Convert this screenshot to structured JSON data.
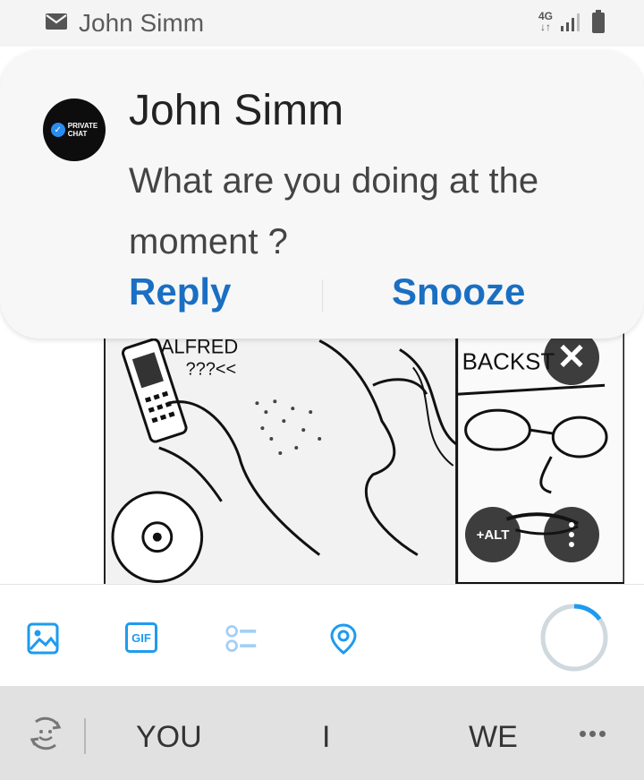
{
  "status_bar": {
    "sender": "John Simm",
    "network_type": "4G",
    "icons": [
      "mail-icon",
      "data-arrows-icon",
      "signal-icon",
      "battery-icon"
    ]
  },
  "notification": {
    "avatar_text_line1": "PRIVATE",
    "avatar_text_line2": "CHAT",
    "title": "John Simm",
    "message": "What are you doing at the moment ?",
    "actions": {
      "reply": "Reply",
      "snooze": "Snooze"
    },
    "accent_color": "#1a6fc2"
  },
  "media": {
    "sketch_text_1": "ALFRED",
    "sketch_text_2": "???<<",
    "sketch_text_3": "BACKST",
    "alt_label": "+ALT",
    "icons": [
      "close-icon",
      "more-vertical-icon"
    ]
  },
  "toolbar": {
    "icons": [
      "image-icon",
      "gif-icon",
      "poll-icon",
      "location-icon"
    ],
    "gif_label": "GIF",
    "accent_color": "#1d9bf0",
    "char_progress": 0.15
  },
  "keyboard": {
    "suggestions": [
      "YOU",
      "I",
      "WE"
    ],
    "icons": [
      "emoji-icon",
      "more-horizontal-icon"
    ]
  }
}
